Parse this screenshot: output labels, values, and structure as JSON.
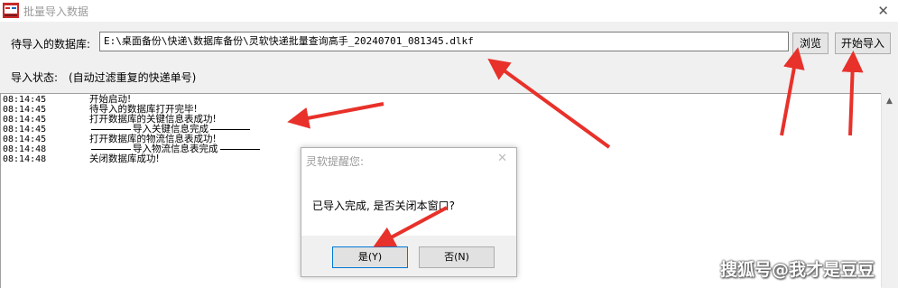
{
  "window": {
    "title": "批量导入数据",
    "close_glyph": "✕"
  },
  "database": {
    "label": "待导入的数据库:",
    "path": "E:\\桌面备份\\快递\\数据库备份\\灵软快递批量查询高手_20240701_081345.dlkf"
  },
  "buttons": {
    "browse": "浏览",
    "start_import": "开始导入"
  },
  "status": {
    "label": "导入状态:",
    "text": "(自动过滤重复的快递单号)"
  },
  "log": [
    {
      "time": "08:14:45",
      "message": "开始启动!"
    },
    {
      "time": "08:14:45",
      "message": "待导入的数据库打开完毕!"
    },
    {
      "time": "08:14:45",
      "message": "打开数据库的关键信息表成功!"
    },
    {
      "time": "08:14:45",
      "message": "导入关键信息完成"
    },
    {
      "time": "08:14:45",
      "message": "打开数据库的物流信息表成功!"
    },
    {
      "time": "08:14:48",
      "message": "导入物流信息表完成"
    },
    {
      "time": "08:14:48",
      "message": "关闭数据库成功!"
    }
  ],
  "dialog": {
    "title": "灵软提醒您:",
    "close_glyph": "✕",
    "message": "已导入完成, 是否关闭本窗口?",
    "yes_label": "是(Y)",
    "no_label": "否(N)"
  },
  "watermark": "搜狐号@我才是豆豆",
  "icons": [
    "app-icon",
    "close-icon",
    "scroll-up-icon",
    "annotation-arrow"
  ],
  "colors": {
    "annotation_arrow": "#e8312a",
    "focus_border": "#0078d7"
  }
}
